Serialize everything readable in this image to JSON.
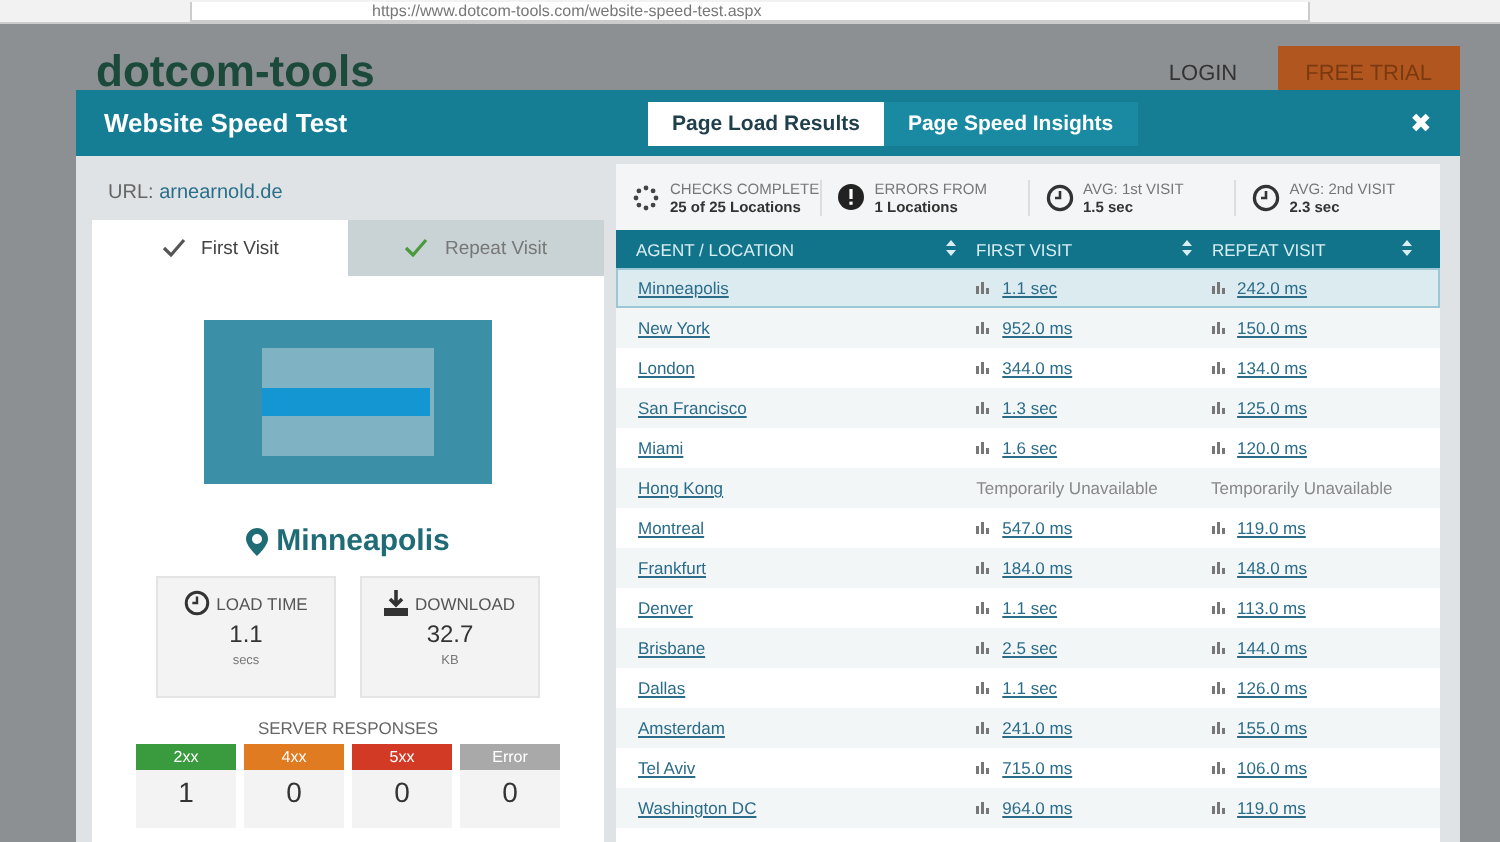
{
  "browser": {
    "url": "https://www.dotcom-tools.com/website-speed-test.aspx"
  },
  "backdrop": {
    "logo": "dotcom-tools",
    "login": "LOGIN",
    "trial": "FREE TRIAL"
  },
  "modal": {
    "title": "Website Speed Test",
    "tabs": [
      {
        "label": "Page Load Results",
        "selected": true
      },
      {
        "label": "Page Speed Insights",
        "selected": false
      }
    ],
    "close": "✖"
  },
  "left": {
    "url_label": "URL:",
    "url": "arnearnold.de",
    "visit_tabs": [
      {
        "label": "First Visit",
        "selected": true
      },
      {
        "label": "Repeat Visit",
        "selected": false
      }
    ],
    "location": "Minneapolis",
    "metrics": [
      {
        "kind": "time",
        "label": "LOAD TIME",
        "value": "1.1",
        "unit": "secs"
      },
      {
        "kind": "download",
        "label": "DOWNLOAD",
        "value": "32.7",
        "unit": "KB"
      }
    ],
    "responses_title": "SERVER RESPONSES",
    "responses": [
      {
        "label": "2xx",
        "count": "1",
        "color": "#3a9a3e"
      },
      {
        "label": "4xx",
        "count": "0",
        "color": "#e07b22"
      },
      {
        "label": "5xx",
        "count": "0",
        "color": "#d23a26"
      },
      {
        "label": "Error",
        "count": "0",
        "color": "#a9a9a9"
      }
    ]
  },
  "stats": [
    {
      "kind": "spinner",
      "label": "CHECKS COMPLETE",
      "value": "25 of 25 Locations"
    },
    {
      "kind": "alert",
      "label": "ERRORS FROM",
      "value": "1 Locations"
    },
    {
      "kind": "clock",
      "label": "AVG: 1st VISIT",
      "value": "1.5 sec"
    },
    {
      "kind": "clock",
      "label": "AVG: 2nd VISIT",
      "value": "2.3 sec"
    }
  ],
  "table": {
    "columns": [
      "AGENT / LOCATION",
      "FIRST VISIT",
      "REPEAT VISIT"
    ],
    "rows": [
      {
        "location": "Minneapolis",
        "first": "1.1 sec",
        "repeat": "242.0 ms",
        "kind": "ok",
        "selected": true
      },
      {
        "location": "New York",
        "first": "952.0 ms",
        "repeat": "150.0 ms",
        "kind": "ok",
        "selected": false
      },
      {
        "location": "London",
        "first": "344.0 ms",
        "repeat": "134.0 ms",
        "kind": "ok",
        "selected": false
      },
      {
        "location": "San Francisco",
        "first": "1.3 sec",
        "repeat": "125.0 ms",
        "kind": "ok",
        "selected": false
      },
      {
        "location": "Miami",
        "first": "1.6 sec",
        "repeat": "120.0 ms",
        "kind": "ok",
        "selected": false
      },
      {
        "location": "Hong Kong",
        "first": "Temporarily Unavailable",
        "repeat": "Temporarily Unavailable",
        "kind": "unavailable",
        "selected": false
      },
      {
        "location": "Montreal",
        "first": "547.0 ms",
        "repeat": "119.0 ms",
        "kind": "ok",
        "selected": false
      },
      {
        "location": "Frankfurt",
        "first": "184.0 ms",
        "repeat": "148.0 ms",
        "kind": "ok",
        "selected": false
      },
      {
        "location": "Denver",
        "first": "1.1 sec",
        "repeat": "113.0 ms",
        "kind": "ok",
        "selected": false
      },
      {
        "location": "Brisbane",
        "first": "2.5 sec",
        "repeat": "144.0 ms",
        "kind": "ok",
        "selected": false
      },
      {
        "location": "Dallas",
        "first": "1.1 sec",
        "repeat": "126.0 ms",
        "kind": "ok",
        "selected": false
      },
      {
        "location": "Amsterdam",
        "first": "241.0 ms",
        "repeat": "155.0 ms",
        "kind": "ok",
        "selected": false
      },
      {
        "location": "Tel Aviv",
        "first": "715.0 ms",
        "repeat": "106.0 ms",
        "kind": "ok",
        "selected": false
      },
      {
        "location": "Washington DC",
        "first": "964.0 ms",
        "repeat": "119.0 ms",
        "kind": "ok",
        "selected": false
      }
    ]
  }
}
